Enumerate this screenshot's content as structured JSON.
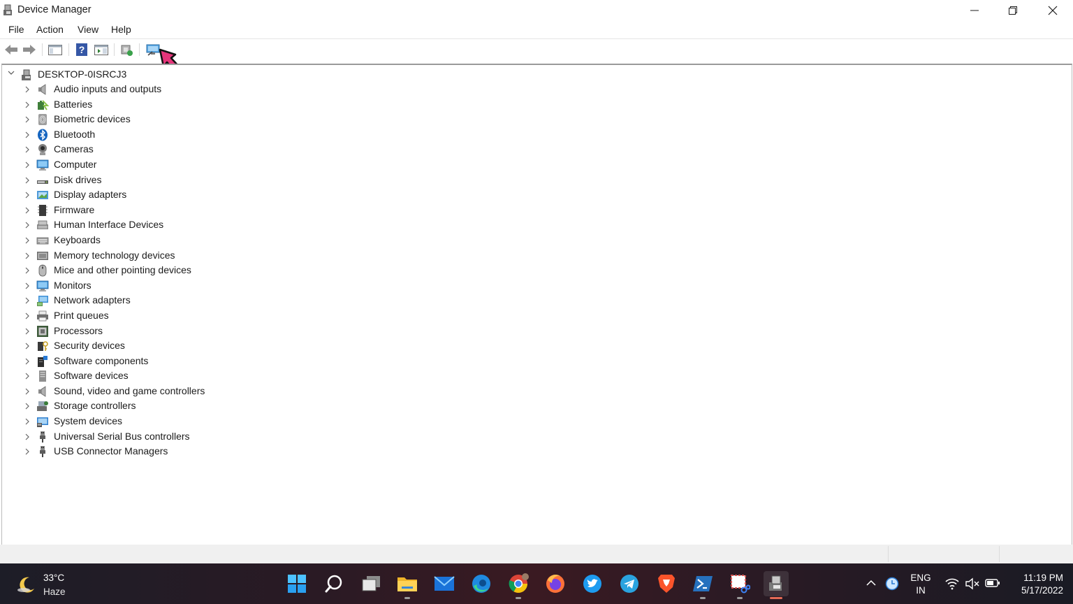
{
  "window": {
    "title": "Device Manager",
    "app_icon": "device-manager-icon",
    "controls": [
      "minimize-icon",
      "restore-icon",
      "close-icon"
    ]
  },
  "menu": {
    "items": [
      {
        "label": "File"
      },
      {
        "label": "Action"
      },
      {
        "label": "View"
      },
      {
        "label": "Help"
      }
    ]
  },
  "toolbar": {
    "buttons": [
      "back-arrow-icon",
      "forward-arrow-icon",
      "show-hide-console-tree-icon",
      "help-icon",
      "show-action-pane-icon",
      "update-driver-icon",
      "scan-hardware-changes-icon"
    ]
  },
  "tree": {
    "root": {
      "label": "DESKTOP-0ISRCJ3",
      "icon": "computer-icon",
      "expanded": true
    },
    "items": [
      {
        "label": "Audio inputs and outputs",
        "icon": "speaker-icon"
      },
      {
        "label": "Batteries",
        "icon": "battery-icon"
      },
      {
        "label": "Biometric devices",
        "icon": "fingerprint-icon"
      },
      {
        "label": "Bluetooth",
        "icon": "bluetooth-icon"
      },
      {
        "label": "Cameras",
        "icon": "camera-icon"
      },
      {
        "label": "Computer",
        "icon": "monitor-icon"
      },
      {
        "label": "Disk drives",
        "icon": "disk-drive-icon"
      },
      {
        "label": "Display adapters",
        "icon": "display-adapter-icon"
      },
      {
        "label": "Firmware",
        "icon": "firmware-icon"
      },
      {
        "label": "Human Interface Devices",
        "icon": "hid-icon"
      },
      {
        "label": "Keyboards",
        "icon": "keyboard-icon"
      },
      {
        "label": "Memory technology devices",
        "icon": "memory-icon"
      },
      {
        "label": "Mice and other pointing devices",
        "icon": "mouse-icon"
      },
      {
        "label": "Monitors",
        "icon": "monitor-icon"
      },
      {
        "label": "Network adapters",
        "icon": "network-adapter-icon"
      },
      {
        "label": "Print queues",
        "icon": "printer-icon"
      },
      {
        "label": "Processors",
        "icon": "processor-icon"
      },
      {
        "label": "Security devices",
        "icon": "security-device-icon"
      },
      {
        "label": "Software components",
        "icon": "software-component-icon"
      },
      {
        "label": "Software devices",
        "icon": "software-device-icon"
      },
      {
        "label": "Sound, video and game controllers",
        "icon": "speaker-icon"
      },
      {
        "label": "Storage controllers",
        "icon": "storage-controller-icon"
      },
      {
        "label": "System devices",
        "icon": "system-device-icon"
      },
      {
        "label": "Universal Serial Bus controllers",
        "icon": "usb-icon"
      },
      {
        "label": "USB Connector Managers",
        "icon": "usb-icon"
      }
    ]
  },
  "taskbar": {
    "weather": {
      "temp": "33°C",
      "condition": "Haze",
      "icon": "moon-icon"
    },
    "apps": [
      "windows-start-icon",
      "search-icon",
      "task-view-icon",
      "file-explorer-icon",
      "mail-icon",
      "edge-icon",
      "chrome-icon",
      "firefox-icon",
      "twitter-icon",
      "telegram-icon",
      "brave-icon",
      "powershell-icon",
      "snipping-tool-icon",
      "device-manager-icon"
    ],
    "tray": {
      "lang_line1": "ENG",
      "lang_line2": "IN",
      "time": "11:19 PM",
      "date": "5/17/2022",
      "icons": [
        "chevron-up-icon",
        "clock-icon",
        "wifi-icon",
        "volume-muted-icon",
        "battery-icon"
      ]
    }
  },
  "colors": {
    "accent": "#0078d4",
    "close_red": "#e81123",
    "pointer_pink": "#e5357a",
    "taskbar_dark": "#1d1d27"
  }
}
